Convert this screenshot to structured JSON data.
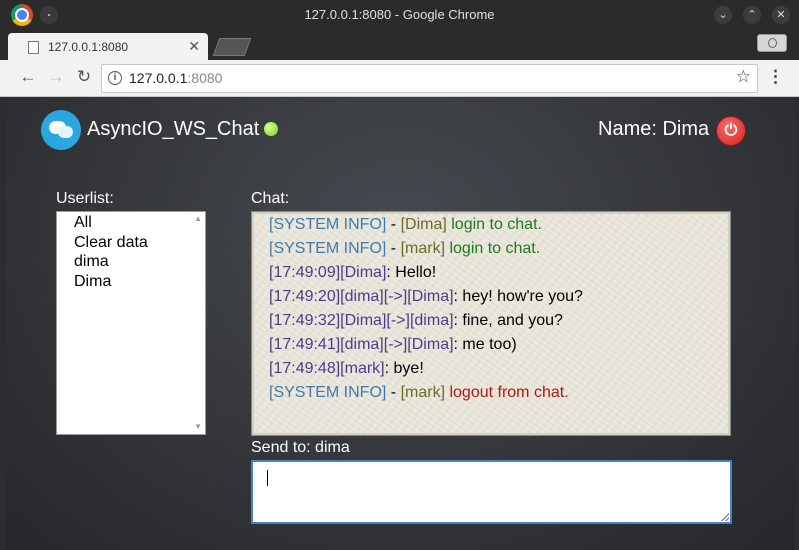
{
  "window": {
    "title": "127.0.0.1:8080 - Google Chrome",
    "controls": {
      "minimize": "⌄",
      "maximize": "⌃",
      "close": "✕"
    }
  },
  "tab": {
    "title": "127.0.0.1:8080",
    "close": "✕"
  },
  "toolbar": {
    "back": "←",
    "forward": "→",
    "reload": "↻",
    "url_host": "127.0.0.1",
    "url_port": ":8080",
    "info": "i",
    "star": "☆",
    "menu": "⋮"
  },
  "header": {
    "app_title": "AsyncIO_WS_Chat",
    "status_color": "#6fd61f",
    "name_label": "Name: Dima",
    "logout_icon": "⏻"
  },
  "userlist": {
    "label": "Userlist:",
    "items": [
      "All",
      "Clear data",
      "dima",
      "Dima"
    ]
  },
  "chat": {
    "label": "Chat:",
    "messages": [
      {
        "prefix": "[SYSTEM INFO]",
        "sep": " - ",
        "user": "[Dima]",
        "text": " login to chat."
      },
      {
        "prefix": "[SYSTEM INFO]",
        "sep": " - ",
        "user": "[mark]",
        "text": " login to chat."
      },
      {
        "prefix": "[17:49:09][Dima]",
        "text": ": Hello!"
      },
      {
        "prefix": "[17:49:20][dima][->][Dima]",
        "text": ": hey! how're you?"
      },
      {
        "prefix": "[17:49:32][Dima][->][dima]",
        "text": ": fine, and you?"
      },
      {
        "prefix": "[17:49:41][dima][->][Dima]",
        "text": ": me too)"
      },
      {
        "prefix": "[17:49:48][mark]",
        "text": ": bye!"
      },
      {
        "prefix": "[SYSTEM INFO]",
        "sep": " - ",
        "user": "[mark]",
        "text": " logout from chat."
      }
    ]
  },
  "send": {
    "label": "Send to: dima",
    "value": ""
  }
}
